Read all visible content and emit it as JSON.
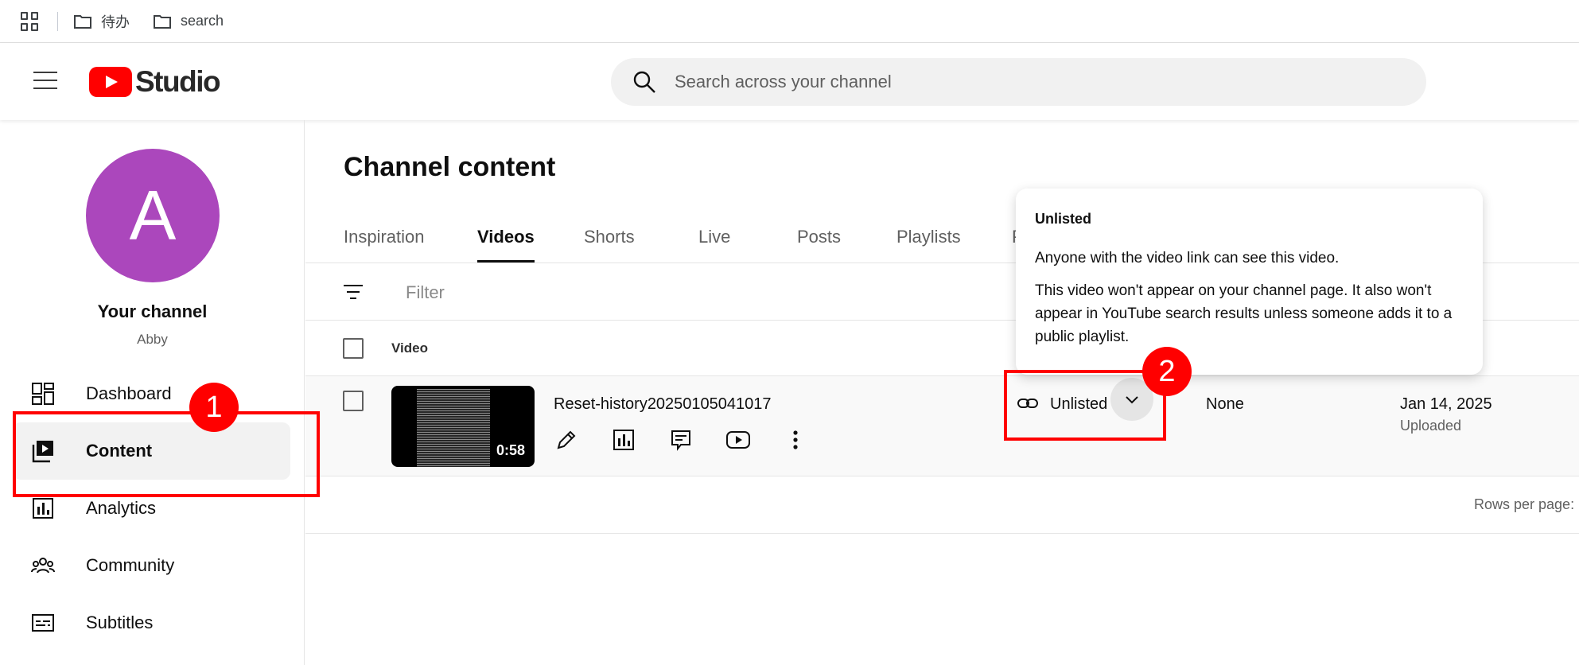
{
  "bookmarks": {
    "items": [
      {
        "label": "待办"
      },
      {
        "label": "search"
      }
    ]
  },
  "header": {
    "logo_text": "Studio",
    "search_placeholder": "Search across your channel"
  },
  "sidebar": {
    "avatar_letter": "A",
    "channel_name": "Your channel",
    "channel_handle": "Abby",
    "items": [
      {
        "label": "Dashboard",
        "icon": "dashboard-icon"
      },
      {
        "label": "Content",
        "icon": "content-icon",
        "active": true
      },
      {
        "label": "Analytics",
        "icon": "analytics-icon"
      },
      {
        "label": "Community",
        "icon": "community-icon"
      },
      {
        "label": "Subtitles",
        "icon": "subtitles-icon"
      }
    ]
  },
  "main": {
    "title": "Channel content",
    "tabs": [
      {
        "label": "Inspiration"
      },
      {
        "label": "Videos",
        "active": true
      },
      {
        "label": "Shorts"
      },
      {
        "label": "Live"
      },
      {
        "label": "Posts"
      },
      {
        "label": "Playlists"
      },
      {
        "label": "P"
      }
    ],
    "filter_label": "Filter",
    "columns": {
      "video": "Video"
    },
    "video": {
      "title": "Reset-history20250105041017",
      "duration": "0:58",
      "visibility": "Unlisted",
      "restrictions": "None",
      "date": "Jan 14, 2025",
      "date_sub": "Uploaded"
    },
    "rows_per_page_label": "Rows per page:"
  },
  "tooltip": {
    "title": "Unlisted",
    "line1": "Anyone with the video link can see this video.",
    "line2": "This video won't appear on your channel page. It also won't appear in YouTube search results unless someone adds it to a public playlist."
  },
  "annotations": {
    "badge1": "1",
    "badge2": "2",
    "color": "#ff0000"
  },
  "colors": {
    "brand_red": "#ff0000",
    "avatar": "#ab47bc"
  }
}
